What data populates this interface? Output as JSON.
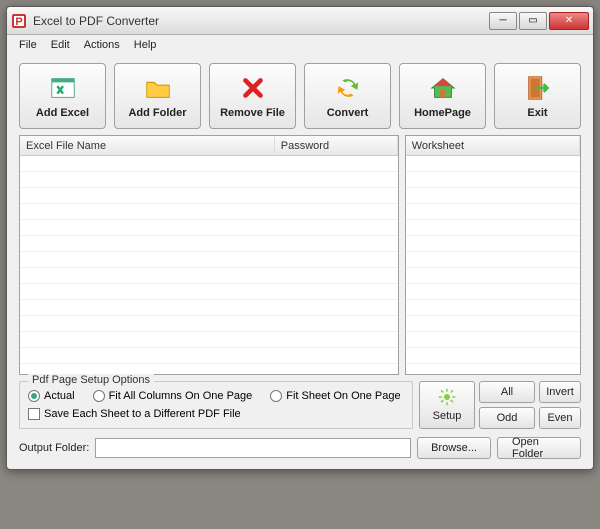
{
  "window": {
    "title": "Excel to PDF Converter"
  },
  "menu": {
    "file": "File",
    "edit": "Edit",
    "actions": "Actions",
    "help": "Help"
  },
  "toolbar": {
    "add_excel": "Add Excel",
    "add_folder": "Add Folder",
    "remove_file": "Remove File",
    "convert": "Convert",
    "homepage": "HomePage",
    "exit": "Exit"
  },
  "columns": {
    "filename": "Excel File Name",
    "password": "Password",
    "worksheet": "Worksheet"
  },
  "pagesetup": {
    "legend": "Pdf Page Setup Options",
    "actual": "Actual",
    "fit_columns": "Fit All Columns On One Page",
    "fit_sheet": "Fit Sheet On One Page",
    "save_each": "Save Each Sheet to a Different PDF File",
    "selected": "actual"
  },
  "selbuttons": {
    "all": "All",
    "invert": "Invert",
    "odd": "Odd",
    "even": "Even",
    "setup": "Setup"
  },
  "output": {
    "label": "Output Folder:",
    "value": "",
    "browse": "Browse...",
    "open": "Open Folder"
  }
}
